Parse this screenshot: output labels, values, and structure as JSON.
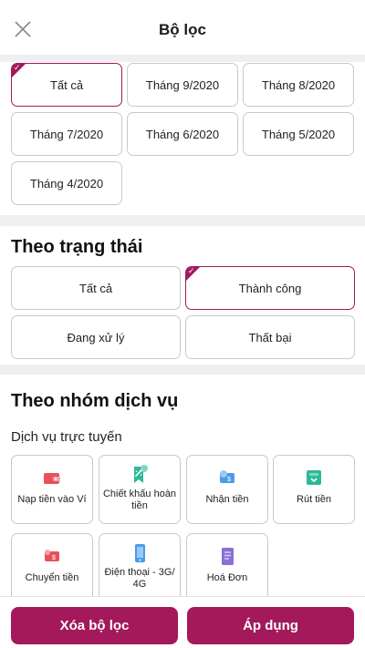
{
  "header": {
    "title": "Bộ lọc",
    "close_icon": "close-icon"
  },
  "time_filter": {
    "options": [
      {
        "label": "Tất cả",
        "selected": true
      },
      {
        "label": "Tháng 9/2020",
        "selected": false
      },
      {
        "label": "Tháng 8/2020",
        "selected": false
      },
      {
        "label": "Tháng 7/2020",
        "selected": false
      },
      {
        "label": "Tháng 6/2020",
        "selected": false
      },
      {
        "label": "Tháng 5/2020",
        "selected": false
      },
      {
        "label": "Tháng 4/2020",
        "selected": false
      }
    ]
  },
  "status_filter": {
    "title": "Theo trạng thái",
    "options": [
      {
        "label": "Tất cả",
        "selected": false
      },
      {
        "label": "Thành công",
        "selected": true
      },
      {
        "label": "Đang xử lý",
        "selected": false
      },
      {
        "label": "Thất bại",
        "selected": false
      }
    ]
  },
  "service_filter": {
    "title": "Theo nhóm dịch vụ",
    "subtitle": "Dịch vụ trực tuyến",
    "items": [
      {
        "label": "Nạp tiền vào Ví",
        "icon": "wallet-topup-icon"
      },
      {
        "label": "Chiết khấu hoàn tiền",
        "icon": "cashback-icon"
      },
      {
        "label": "Nhận tiền",
        "icon": "receive-money-icon"
      },
      {
        "label": "Rút tiền",
        "icon": "withdraw-icon"
      },
      {
        "label": "Chuyển tiền",
        "icon": "transfer-money-icon"
      },
      {
        "label": "Điện thoại - 3G/ 4G",
        "icon": "phone-icon"
      },
      {
        "label": "Hoá Đơn",
        "icon": "bill-icon"
      }
    ]
  },
  "footer": {
    "clear_label": "Xóa bộ lọc",
    "apply_label": "Áp dụng"
  },
  "colors": {
    "accent": "#a3195b",
    "icon_red": "#e8505b",
    "icon_green": "#2bb99a",
    "icon_blue": "#4a9be8",
    "icon_purple": "#8a6fd6"
  }
}
